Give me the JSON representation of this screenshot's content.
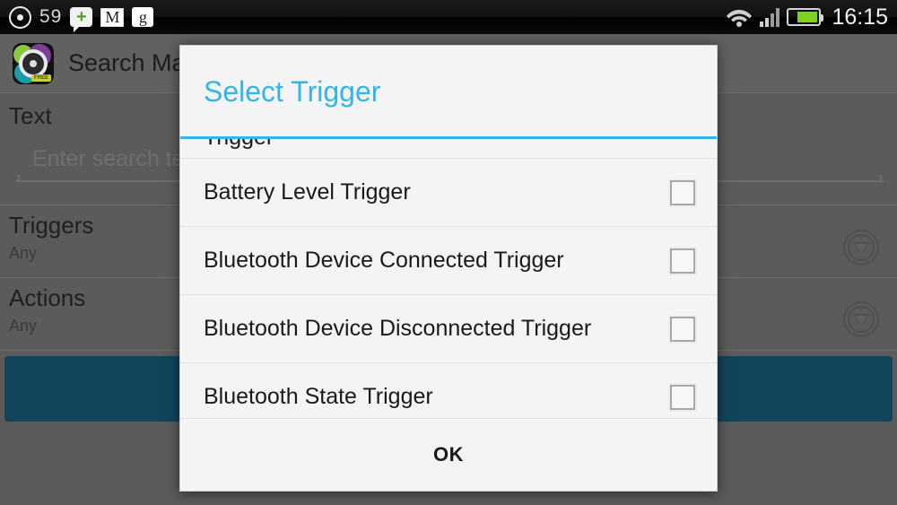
{
  "statusbar": {
    "notification_count": "59",
    "clock": "16:15",
    "icons": {
      "record": "circle-dot-icon",
      "hangouts": "hangouts-icon",
      "hangouts_glyph": "+",
      "gmail": "gmail-icon",
      "gmail_glyph": "M",
      "gplus": "google-plus-icon",
      "gplus_glyph": "g",
      "wifi": "wifi-icon",
      "signal": "cellular-signal-icon",
      "battery": "battery-icon"
    }
  },
  "app": {
    "title": "Search Man",
    "icon_name": "app-icon-search-man",
    "icon_badge": "FREE",
    "sections": [
      {
        "label": "Text",
        "sub": ""
      },
      {
        "label": "Triggers",
        "sub": "Any"
      },
      {
        "label": "Actions",
        "sub": "Any"
      }
    ],
    "search": {
      "placeholder": "Enter search text",
      "value": ""
    },
    "expander_icon": "chevron-down-circle-icon",
    "accent_teal": "#11455c"
  },
  "dialog": {
    "title": "Select Trigger",
    "title_color": "#33b5e5",
    "divider_color": "#33b5e5",
    "scrolled_item_label": "Trigger",
    "items": [
      {
        "label": "Battery Level Trigger",
        "checked": false
      },
      {
        "label": "Bluetooth Device Connected Trigger",
        "checked": false
      },
      {
        "label": "Bluetooth Device Disconnected Trigger",
        "checked": false
      },
      {
        "label": "Bluetooth State Trigger",
        "checked": false
      }
    ],
    "ok_label": "OK"
  }
}
